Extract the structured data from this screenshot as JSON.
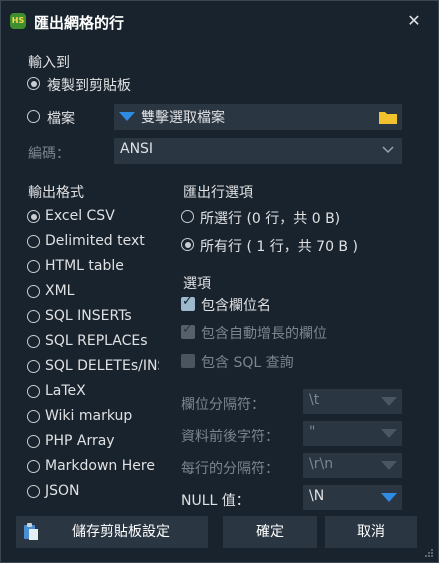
{
  "window": {
    "title": "匯出網格的行",
    "app_icon": "HS"
  },
  "output_to": {
    "heading": "輸入到",
    "clipboard_label": "複製到剪貼板",
    "file_label": "檔案",
    "file_picker_text": "雙擊選取檔案",
    "encoding_label": "編碼：",
    "encoding_value": "ANSI"
  },
  "format": {
    "heading": "輸出格式",
    "options": [
      "Excel CSV",
      "Delimited text",
      "HTML table",
      "XML",
      "SQL INSERTs",
      "SQL REPLACEs",
      "SQL DELETEs/INSERTs",
      "LaTeX",
      "Wiki markup",
      "PHP Array",
      "Markdown Here",
      "JSON"
    ],
    "selected": "Excel CSV"
  },
  "rows": {
    "heading": "匯出行選項",
    "selected_label": "所選行 (0 行，共 0 B)",
    "all_label": "所有行 ( 1 行，共 70 B )"
  },
  "options": {
    "heading": "選項",
    "include_headers": "包含欄位名",
    "include_autoinc": "包含自動增長的欄位",
    "include_sql": "包含 SQL 查詢",
    "field_sep_label": "欄位分隔符：",
    "field_sep_value": "\\t",
    "encloser_label": "資料前後字符：",
    "encloser_value": "\"",
    "line_sep_label": "每行的分隔符：",
    "line_sep_value": "\\r\\n",
    "null_label": "NULL 值：",
    "null_value": "\\N"
  },
  "buttons": {
    "clipboard_settings": "儲存剪貼板設定",
    "ok": "確定",
    "cancel": "取消"
  },
  "colors": {
    "background": "#19232d",
    "field": "#2a3642",
    "accent_blue": "#2f8ae2",
    "folder": "#f2c12e"
  }
}
